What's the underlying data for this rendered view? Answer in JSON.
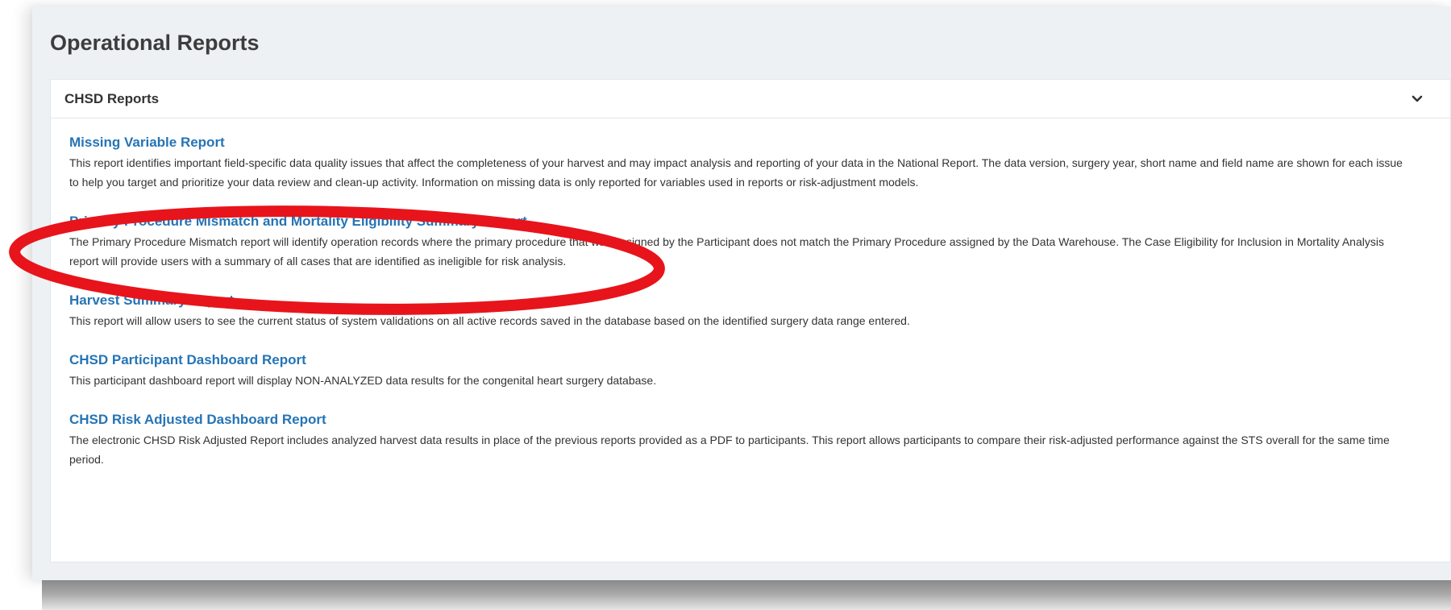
{
  "page": {
    "title": "Operational Reports"
  },
  "panel": {
    "title": "CHSD Reports",
    "toggle_icon": "chevron-down-icon"
  },
  "reports": [
    {
      "title": "Missing Variable Report",
      "description": "This report identifies important field-specific data quality issues that affect the completeness of your harvest and may impact analysis and reporting of your data in the National Report. The data version, surgery year, short name and field name are shown for each issue to help you target and prioritize your data review and clean-up activity.  Information on missing data is only reported for variables used in reports or risk-adjustment models."
    },
    {
      "title": "Primary Procedure Mismatch and Mortality Eligibility Summary Report",
      "description": "The Primary Procedure Mismatch report will identify operation records where the primary procedure that was assigned by the Participant does not match the Primary Procedure assigned by the Data Warehouse. The Case Eligibility for Inclusion in Mortality Analysis report will provide users with a summary of all cases that are identified as ineligible for risk analysis."
    },
    {
      "title": "Harvest Summary Report",
      "description": "This report will allow users to see the current status of system validations on all active records saved in the database based on the identified surgery data range entered."
    },
    {
      "title": "CHSD Participant Dashboard Report",
      "description": "This participant dashboard report will display NON-ANALYZED data results for the congenital heart surgery database."
    },
    {
      "title": "CHSD Risk Adjusted Dashboard Report",
      "description": "The electronic CHSD Risk Adjusted Report includes analyzed harvest data results in place of the previous reports provided as a PDF to participants. This report allows participants to compare their risk-adjusted performance against the STS overall for the same time period."
    }
  ],
  "colors": {
    "link": "#2574b5",
    "annotation_circle": "#e8141b",
    "page_background": "#eef1f4"
  }
}
